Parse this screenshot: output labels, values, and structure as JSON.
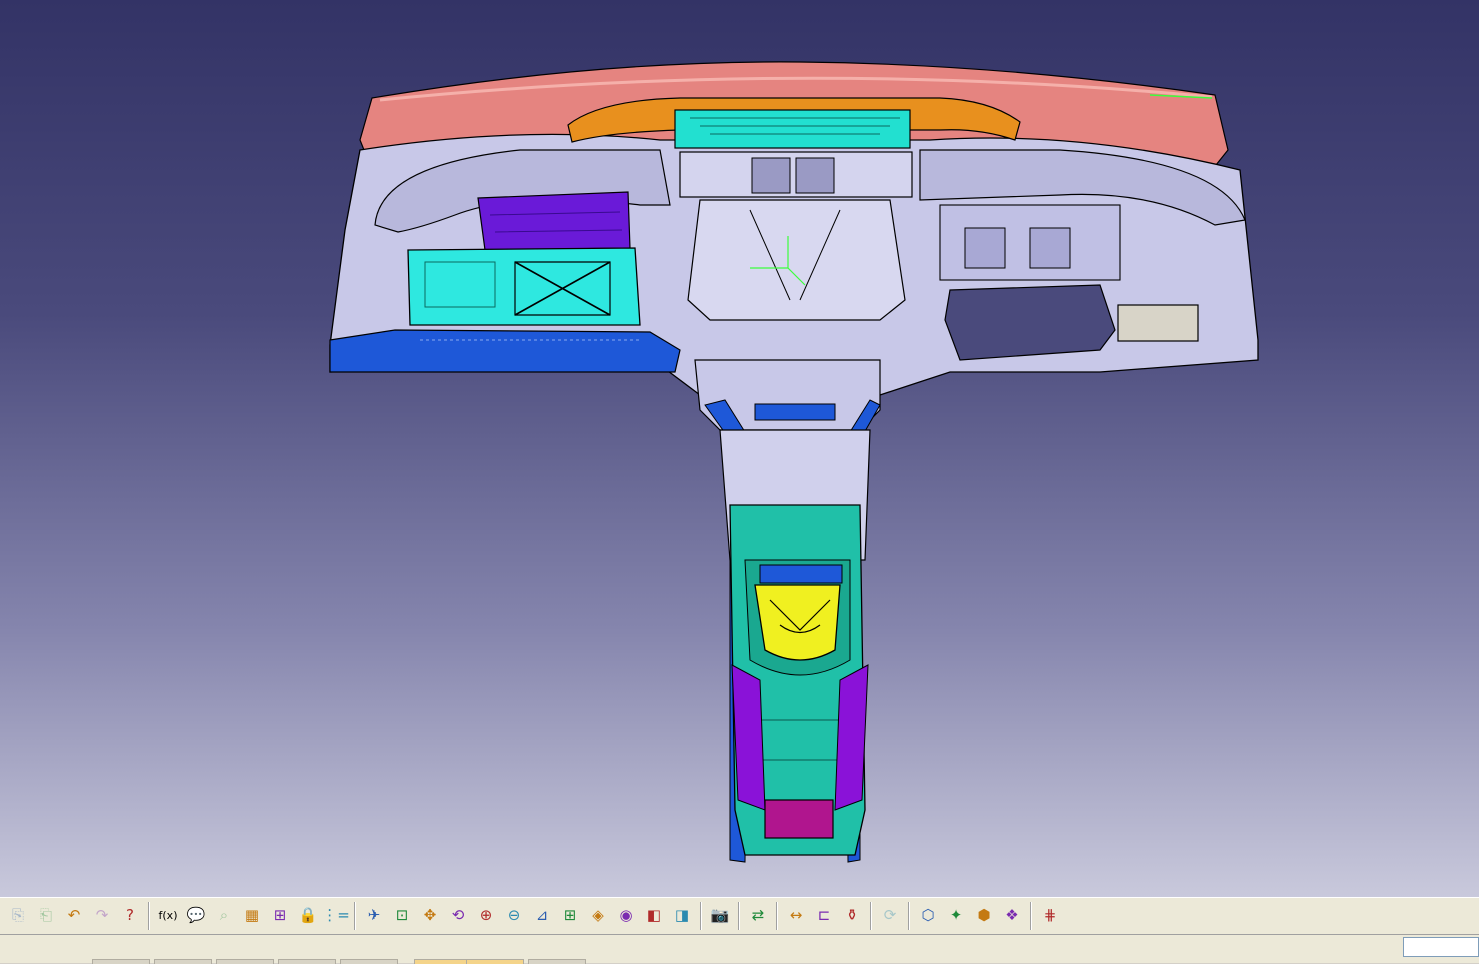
{
  "viewport": {
    "background_top": "#333366",
    "background_bottom": "#c9c9dc",
    "model": "instrument-panel-assembly",
    "axis_compass": "xyz-axis-icon"
  },
  "colors": {
    "cross_car_beam": "#e58480",
    "duct_orange": "#e8901e",
    "vent_cyan": "#22e0d0",
    "body_lavender": "#c8c8e8",
    "airbag_purple": "#6a1ad8",
    "glovebox_cyan": "#2ee8e0",
    "bracket_blue": "#1e58d8",
    "console_teal": "#20c0a8",
    "cupholder_yellow": "#f0f020",
    "console_purple": "#8a12d8",
    "bin_magenta": "#b0158e",
    "edge_black": "#000000"
  },
  "toolbar": {
    "icons": [
      {
        "name": "copy-icon",
        "glyph": "⎘",
        "enabled": false
      },
      {
        "name": "paste-icon",
        "glyph": "⎗",
        "enabled": false
      },
      {
        "name": "undo-icon",
        "glyph": "↶",
        "enabled": true
      },
      {
        "name": "redo-icon",
        "glyph": "↷",
        "enabled": false
      },
      {
        "name": "whats-this-icon",
        "glyph": "?",
        "enabled": true
      },
      {
        "name": "formula-icon",
        "glyph": "f(x)",
        "enabled": true
      },
      {
        "name": "comment-icon",
        "glyph": "💬",
        "enabled": true
      },
      {
        "name": "knowledge-icon",
        "glyph": "⌕",
        "enabled": false
      },
      {
        "name": "table-icon",
        "glyph": "▦",
        "enabled": true
      },
      {
        "name": "tree-icon",
        "glyph": "⊞",
        "enabled": true
      },
      {
        "name": "lock-icon",
        "glyph": "🔒",
        "enabled": true
      },
      {
        "name": "parameters-icon",
        "glyph": "⋮=",
        "enabled": true
      },
      {
        "name": "fly-mode-icon",
        "glyph": "✈",
        "enabled": true
      },
      {
        "name": "fit-all-icon",
        "glyph": "⊡",
        "enabled": true
      },
      {
        "name": "pan-icon",
        "glyph": "✥",
        "enabled": true
      },
      {
        "name": "rotate-icon",
        "glyph": "⟲",
        "enabled": true
      },
      {
        "name": "zoom-in-icon",
        "glyph": "⊕",
        "enabled": true
      },
      {
        "name": "zoom-out-icon",
        "glyph": "⊖",
        "enabled": true
      },
      {
        "name": "normal-view-icon",
        "glyph": "⊿",
        "enabled": true
      },
      {
        "name": "multi-view-icon",
        "glyph": "⊞",
        "enabled": true
      },
      {
        "name": "iso-view-icon",
        "glyph": "◈",
        "enabled": true
      },
      {
        "name": "shading-icon",
        "glyph": "◉",
        "enabled": true
      },
      {
        "name": "hide-show-icon",
        "glyph": "◧",
        "enabled": true
      },
      {
        "name": "swap-space-icon",
        "glyph": "◨",
        "enabled": true
      },
      {
        "name": "capture-icon",
        "glyph": "📷",
        "enabled": true
      },
      {
        "name": "move-icon",
        "glyph": "⇄",
        "enabled": true
      },
      {
        "name": "measure-between-icon",
        "glyph": "↔",
        "enabled": true
      },
      {
        "name": "measure-item-icon",
        "glyph": "⊏",
        "enabled": true
      },
      {
        "name": "measure-inertia-icon",
        "glyph": "⚱",
        "enabled": true
      },
      {
        "name": "update-icon",
        "glyph": "⟳",
        "enabled": false
      },
      {
        "name": "apply-material-icon",
        "glyph": "⬡",
        "enabled": true
      },
      {
        "name": "catalog-icon",
        "glyph": "✦",
        "enabled": true
      },
      {
        "name": "render-icon",
        "glyph": "⬢",
        "enabled": true
      },
      {
        "name": "scene-icon",
        "glyph": "❖",
        "enabled": true
      },
      {
        "name": "grid-icon",
        "glyph": "⋕",
        "enabled": true
      }
    ]
  },
  "statusbar": {
    "command_placeholder": ""
  }
}
